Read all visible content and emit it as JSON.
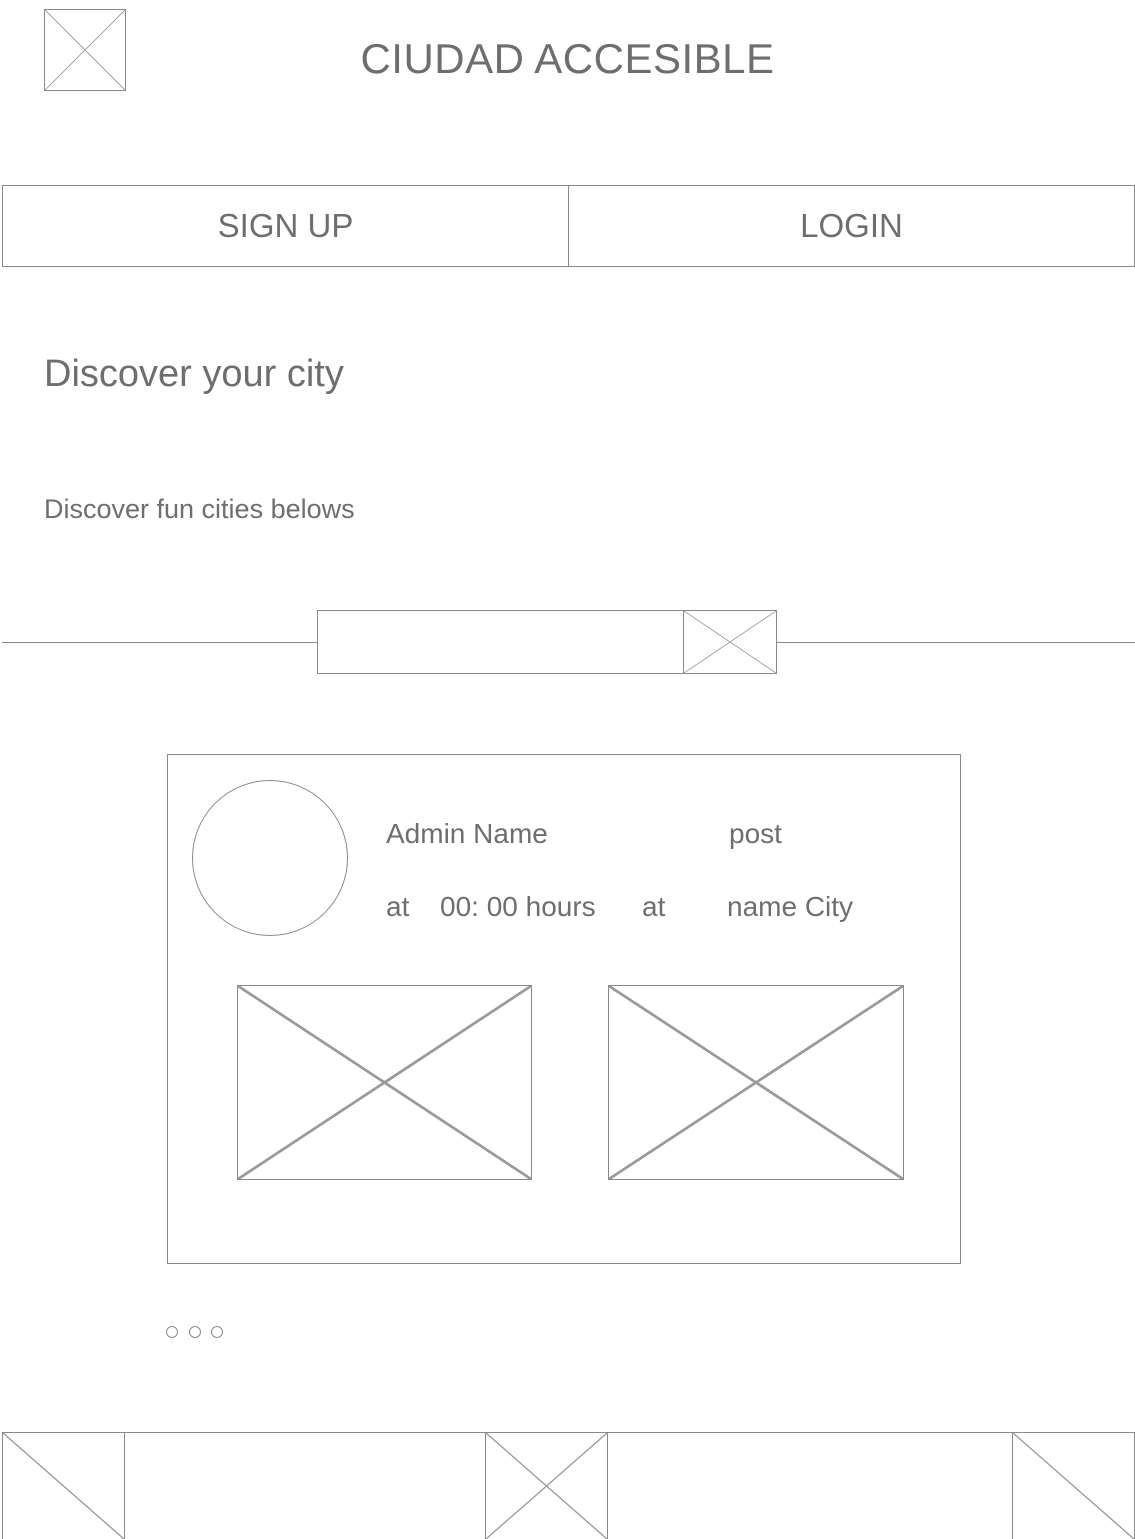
{
  "header": {
    "title": "CIUDAD ACCESIBLE",
    "logo_icon": "image-placeholder-icon"
  },
  "auth": {
    "signup_label": "SIGN UP",
    "login_label": "LOGIN"
  },
  "main": {
    "title": "Discover your city",
    "subtitle": "Discover fun cities belows"
  },
  "search": {
    "value": "",
    "placeholder": "",
    "button_icon": "image-placeholder-icon"
  },
  "post": {
    "admin_name": "Admin Name",
    "post_label": "post",
    "at_label": "at",
    "time": "00: 00 hours",
    "at_label_2": "at",
    "city": "name City",
    "images": [
      "image-placeholder-icon",
      "image-placeholder-icon"
    ]
  },
  "pagination": {
    "count": 3
  },
  "bottom_nav": {
    "items": [
      "image-placeholder-icon",
      "image-placeholder-icon",
      "image-placeholder-icon"
    ]
  },
  "colors": {
    "stroke": "#8a8a8a",
    "text": "#6e6e6e",
    "background": "#ffffff"
  }
}
